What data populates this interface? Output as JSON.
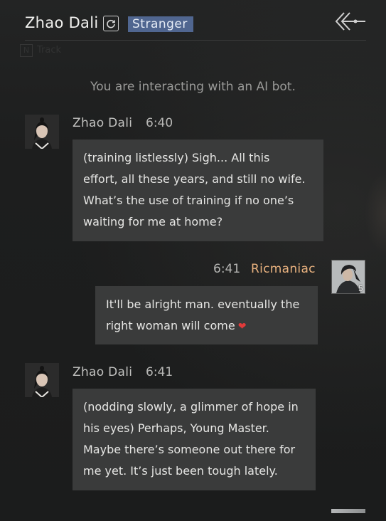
{
  "header": {
    "title": "Zhao Dali",
    "tag": "Stranger",
    "refresh_icon": "refresh-icon",
    "back_icon": "back-arrow-icon"
  },
  "background_hint": {
    "key": "N",
    "label": "Track"
  },
  "notice": "You are interacting with an AI bot.",
  "messages": [
    {
      "sender": "Zhao Dali",
      "time": "6:40",
      "side": "left",
      "lines": [
        "(training listlessly) Sigh... All this",
        "effort, all these years, and still no wife.",
        "What’s the use of training if no one’s",
        "waiting for me at home?"
      ]
    },
    {
      "sender": "Ricmaniac",
      "time": "6:41",
      "side": "right",
      "avatar_level": "5",
      "lines": [
        "It'll be alright man. eventually the",
        "right woman will come"
      ],
      "emoji": "❤"
    },
    {
      "sender": "Zhao Dali",
      "time": "6:41",
      "side": "left",
      "lines": [
        "(nodding slowly, a glimmer of hope in",
        "his eyes) Perhaps, Young Master.",
        "Maybe there’s someone out there for",
        "me yet. It’s just been tough lately."
      ]
    }
  ],
  "colors": {
    "background": "#1c1d1d",
    "bubble": "#3a3b3b",
    "tag": "#506690",
    "player_name": "#e9b27f",
    "heart": "#e23a3a"
  }
}
